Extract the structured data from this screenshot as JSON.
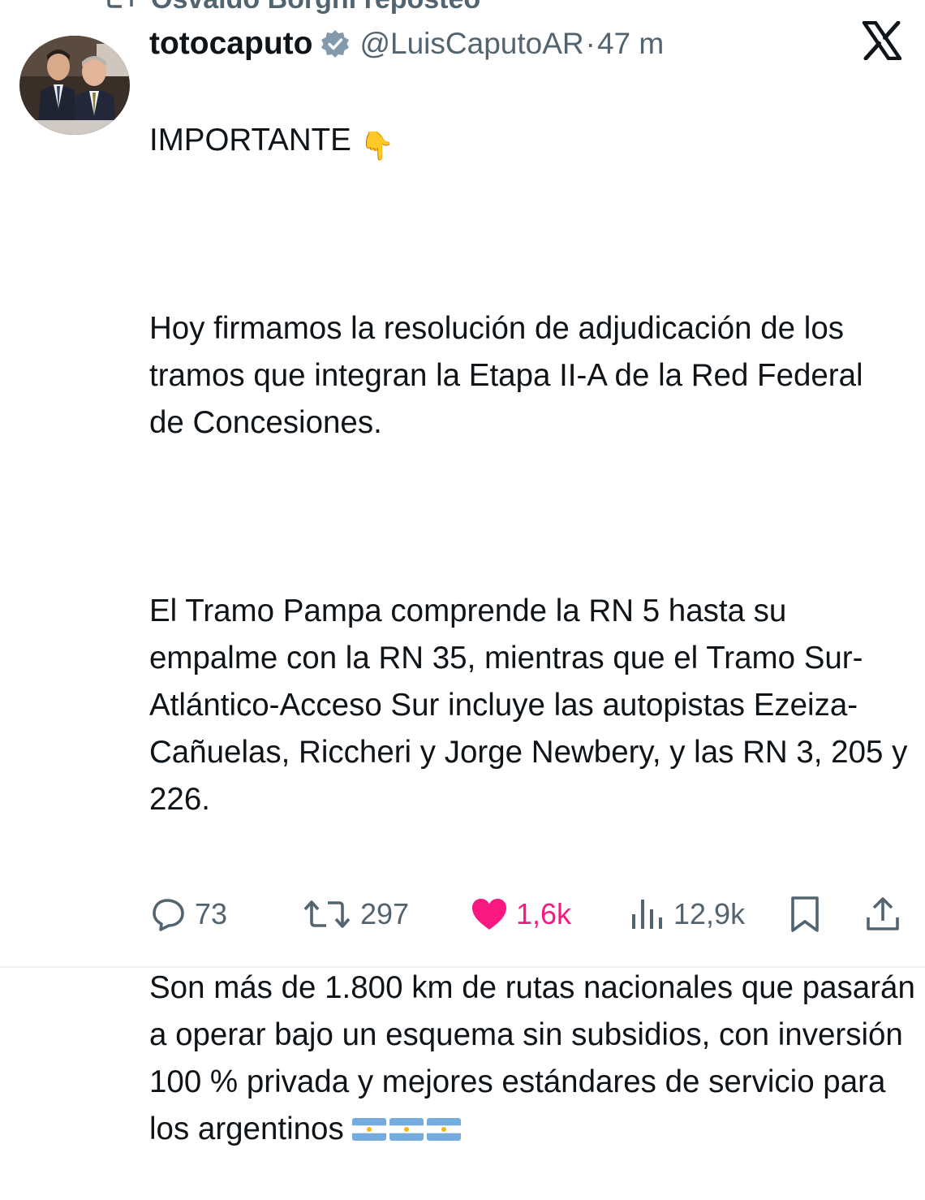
{
  "repost": {
    "text": "Osvaldo Borghi reposteó",
    "icon": "repost-icon"
  },
  "tweet": {
    "author_name": "totocaputo",
    "verified_icon": "verified-badge-icon",
    "handle": "@LuisCaputoAR",
    "separator": "·",
    "time": "47 m",
    "platform_icon": "x-logo-icon",
    "headline": "IMPORTANTE",
    "headline_emoji": "👇",
    "paragraphs": [
      "Hoy firmamos la resolución de adjudicación de los tramos que integran la Etapa II-A de la Red Federal de Concesiones.",
      "El Tramo Pampa comprende la RN 5 hasta su empalme con la RN 35, mientras que el Tramo Sur-Atlántico-Acceso Sur incluye las autopistas Ezeiza-Cañuelas, Riccheri y Jorge Newbery, y las RN 3, 205 y 226.",
      "Son más de 1.800 km de rutas nacionales que pasarán a operar bajo un esquema sin subsidios, con inversión 100 % privada y mejores estándares de servicio para los argentinos"
    ],
    "flags": [
      "🇦🇷",
      "🇦🇷",
      "🇦🇷"
    ]
  },
  "actions": {
    "replies": "73",
    "reposts": "297",
    "likes": "1,6k",
    "views": "12,9k",
    "like_color": "#f91880",
    "muted_color": "#536471"
  }
}
